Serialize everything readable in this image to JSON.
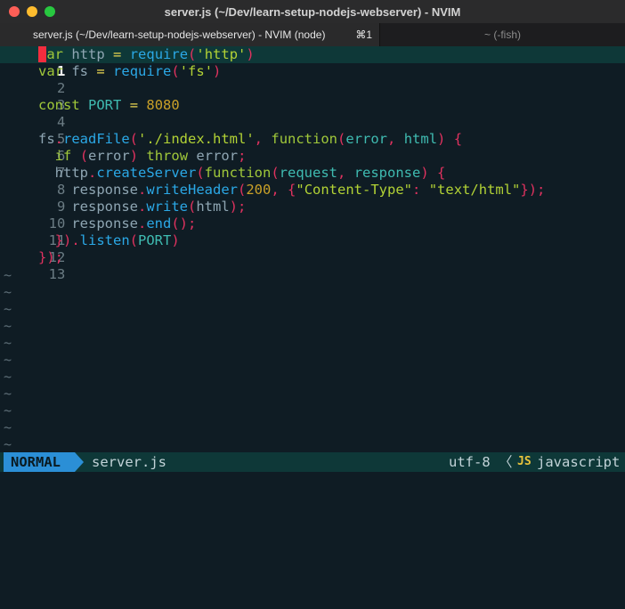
{
  "window": {
    "title": "server.js (~/Dev/learn-setup-nodejs-webserver) - NVIM"
  },
  "tabs": [
    {
      "label": "server.js (~/Dev/learn-setup-nodejs-webserver) - NVIM (node)",
      "shortcut": "⌘1"
    },
    {
      "label": "~ (-fish)"
    }
  ],
  "editor": {
    "line_numbers": [
      "1",
      "2",
      "3",
      "4",
      "5",
      "6",
      "7",
      "8",
      "9",
      "10",
      "11",
      "12",
      "13"
    ],
    "current_line": 1,
    "cursor_char": "v",
    "lines": [
      "ar http = require('http')",
      "var fs = require('fs')",
      "",
      "const PORT = 8080",
      "",
      "fs.readFile('./index.html', function(error, html) {",
      "  if (error) throw error;",
      "  http.createServer(function(request, response) {",
      "    response.writeHeader(200, {\"Content-Type\": \"text/html\"});",
      "    response.write(html);",
      "    response.end();",
      "  }).listen(PORT)",
      "});"
    ],
    "tilde": "~"
  },
  "statusline": {
    "mode": "NORMAL",
    "filename": "server.js",
    "encoding": "utf-8",
    "separator": "〈",
    "filetype_icon": "JS",
    "filetype": "javascript"
  }
}
